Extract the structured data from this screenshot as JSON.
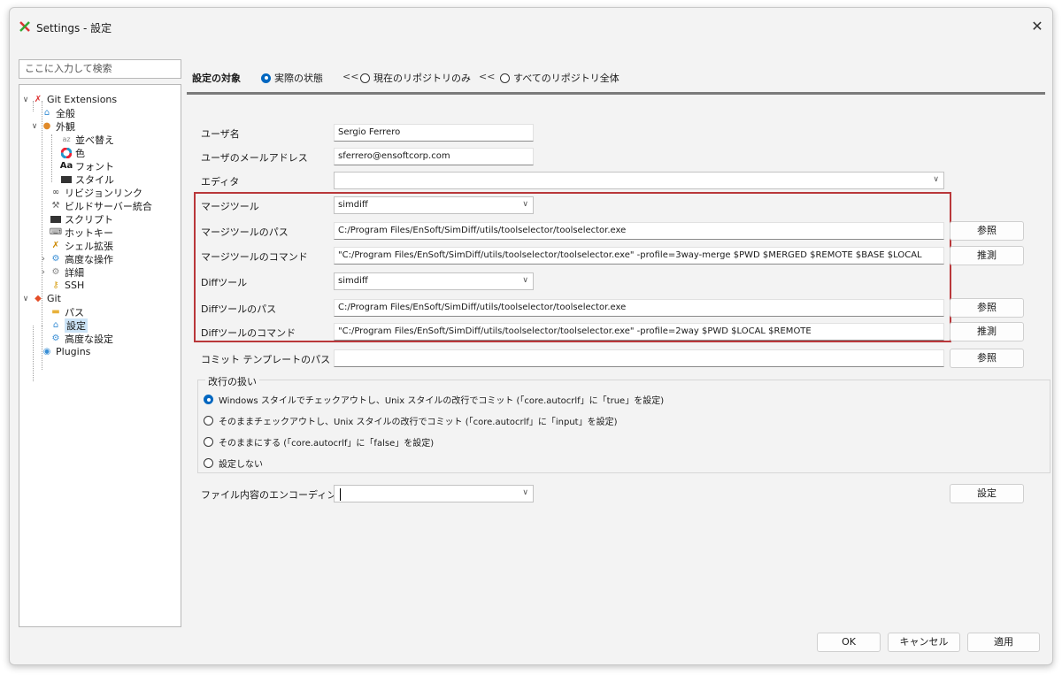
{
  "window": {
    "title": "Settings - 設定"
  },
  "search": {
    "placeholder": "ここに入力して検索"
  },
  "tree": {
    "git_extensions": "Git Extensions",
    "general": "全般",
    "appearance": "外観",
    "sort": "並べ替え",
    "color": "色",
    "font": "フォント",
    "style": "スタイル",
    "revision_links": "リビジョンリンク",
    "build_server": "ビルドサーバー統合",
    "scripts": "スクリプト",
    "hotkeys": "ホットキー",
    "shell_ext": "シェル拡張",
    "advanced_ops": "高度な操作",
    "details": "詳細",
    "ssh": "SSH",
    "git": "Git",
    "path": "パス",
    "settings": "設定",
    "advanced_settings": "高度な設定",
    "plugins": "Plugins"
  },
  "scope": {
    "title": "設定の対象",
    "effective": "実際の状態",
    "sep1": "<<",
    "local": "現在のリポジトリのみ",
    "sep2": "<<",
    "global": "すべてのリポジトリ全体"
  },
  "form": {
    "username_label": "ユーザ名",
    "username_value": "Sergio Ferrero",
    "email_label": "ユーザのメールアドレス",
    "email_value": "sferrero@ensoftcorp.com",
    "editor_label": "エディタ",
    "editor_value": "",
    "mergetool_label": "マージツール",
    "mergetool_value": "simdiff",
    "mergetool_path_label": "マージツールのパス",
    "mergetool_path_value": "C:/Program Files/EnSoft/SimDiff/utils/toolselector/toolselector.exe",
    "mergetool_cmd_label": "マージツールのコマンド",
    "mergetool_cmd_value": "\"C:/Program Files/EnSoft/SimDiff/utils/toolselector/toolselector.exe\" -profile=3way-merge $PWD $MERGED $REMOTE $BASE $LOCAL",
    "difftool_label": "Diffツール",
    "difftool_value": "simdiff",
    "difftool_path_label": "Diffツールのパス",
    "difftool_path_value": "C:/Program Files/EnSoft/SimDiff/utils/toolselector/toolselector.exe",
    "difftool_cmd_label": "Diffツールのコマンド",
    "difftool_cmd_value": "\"C:/Program Files/EnSoft/SimDiff/utils/toolselector/toolselector.exe\" -profile=2way $PWD $LOCAL $REMOTE",
    "commit_template_label": "コミット テンプレートのパス",
    "commit_template_value": "",
    "browse": "参照",
    "guess": "推測",
    "encoding_label": "ファイル内容のエンコーディング",
    "encoding_value": "",
    "set_button": "設定"
  },
  "line_endings": {
    "title": "改行の扱い",
    "opt1": "Windows スタイルでチェックアウトし、Unix スタイルの改行でコミット (「core.autocrlf」に「true」を設定)",
    "opt2": "そのままチェックアウトし、Unix スタイルの改行でコミット (「core.autocrlf」に「input」を設定)",
    "opt3": "そのままにする (「core.autocrlf」に「false」を設定)",
    "opt4": "設定しない",
    "selected": 1
  },
  "footer": {
    "ok": "OK",
    "cancel": "キャンセル",
    "apply": "適用"
  },
  "colors": {
    "accent": "#0067c0",
    "highlight_border": "#b9373a",
    "selection": "#cce4f7"
  }
}
